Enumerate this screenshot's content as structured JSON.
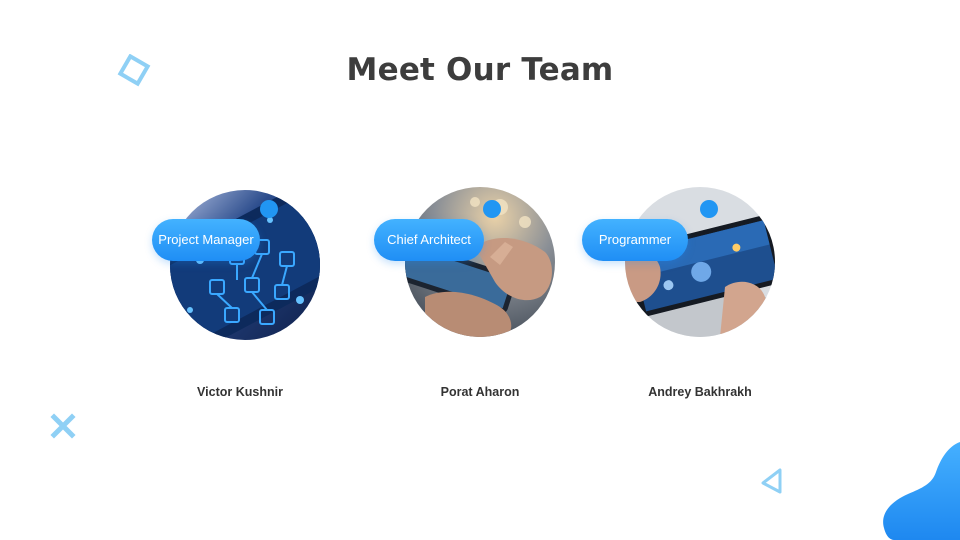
{
  "slide": {
    "title": "Meet Our Team"
  },
  "team": [
    {
      "role": "Project Manager",
      "name": "Victor Kushnir",
      "photo": "smartphone-app-icons"
    },
    {
      "role": "Chief Architect",
      "name": "Porat Aharon",
      "photo": "hands-holding-phone"
    },
    {
      "role": "Programmer",
      "name": "Andrey Bakhrakh",
      "photo": "mobile-game-on-phone"
    }
  ],
  "colors": {
    "accent": "#2196f3",
    "accent_light": "#43b2ff",
    "title": "#3d3d3d",
    "decor": "#8fd0f5"
  },
  "decorations": [
    "diamond-outline-icon",
    "x-mark-icon",
    "triangle-outline-icon",
    "blob-shape"
  ]
}
